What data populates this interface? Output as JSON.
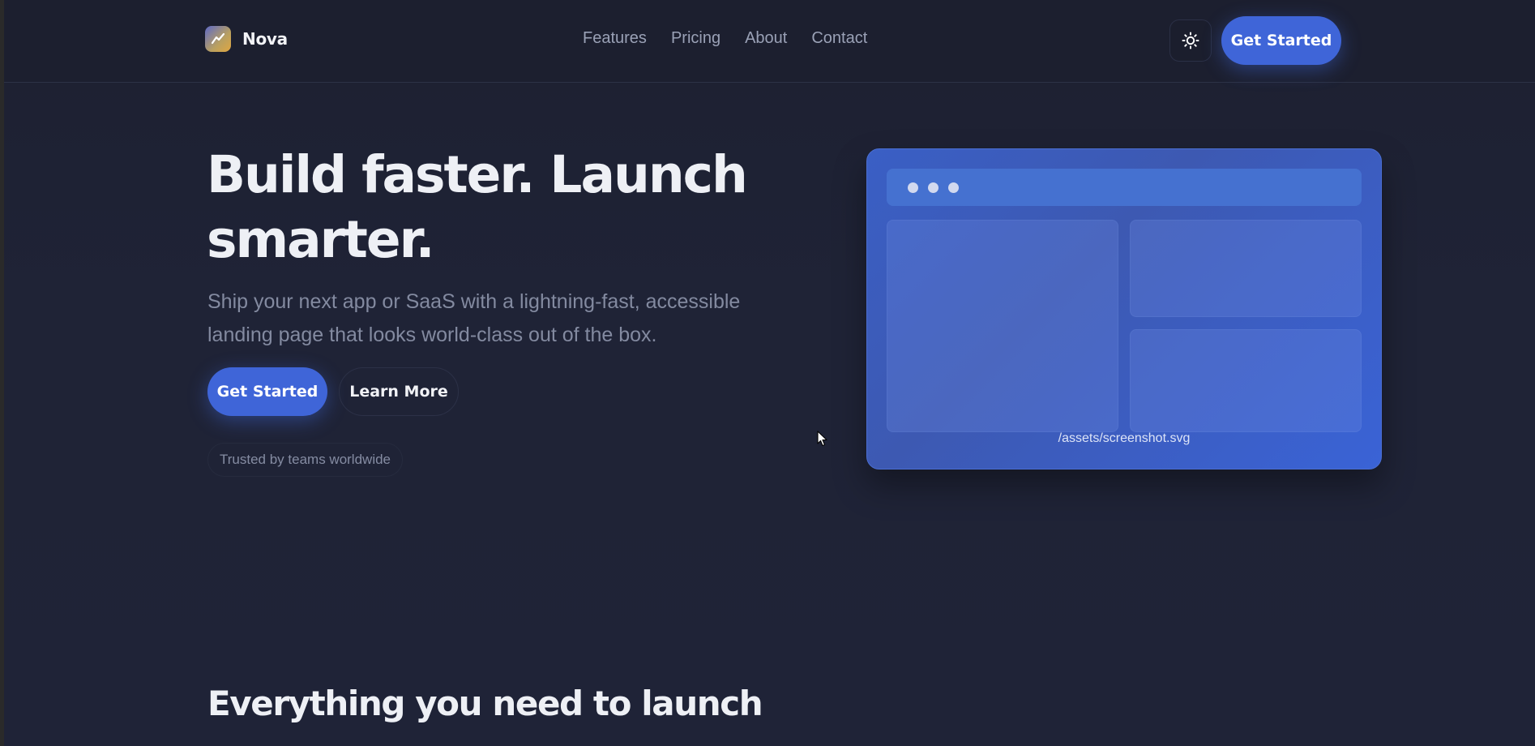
{
  "brand": {
    "name": "Nova",
    "logo_icon": "chart-line-icon"
  },
  "nav": {
    "items": [
      {
        "label": "Features"
      },
      {
        "label": "Pricing"
      },
      {
        "label": "About"
      },
      {
        "label": "Contact"
      }
    ]
  },
  "header": {
    "theme_icon": "sun-icon",
    "cta_label": "Get Started"
  },
  "hero": {
    "title": "Build faster. Launch smarter.",
    "subtitle": "Ship your next app or SaaS with a lightning-fast, accessible landing page that looks world-class out of the box.",
    "primary_label": "Get Started",
    "secondary_label": "Learn More",
    "trusted_label": "Trusted by teams worldwide"
  },
  "mockup": {
    "caption": "/assets/screenshot.svg"
  },
  "section": {
    "title": "Everything you need to launch"
  },
  "colors": {
    "background": "#1f2336",
    "accent": "#3f65d8",
    "muted_text": "#838aa0"
  }
}
